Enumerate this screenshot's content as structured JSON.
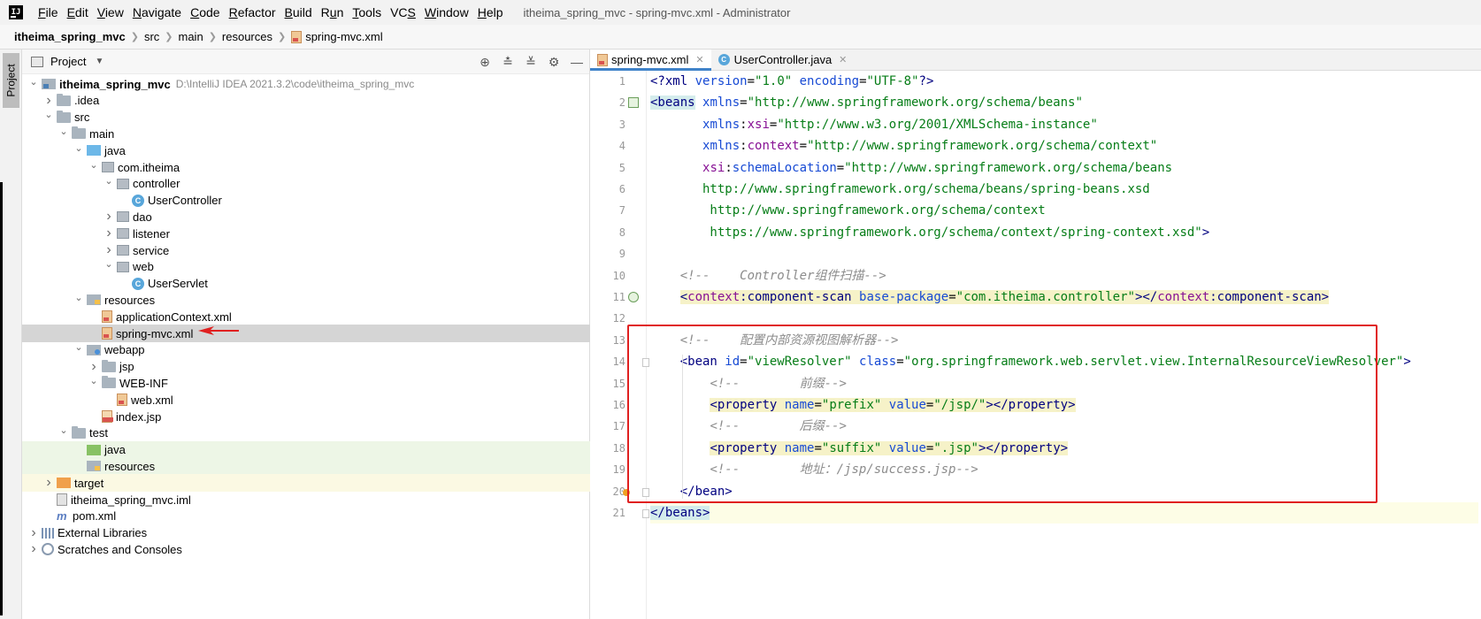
{
  "menubar": {
    "items": [
      "File",
      "Edit",
      "View",
      "Navigate",
      "Code",
      "Refactor",
      "Build",
      "Run",
      "Tools",
      "VCS",
      "Window",
      "Help"
    ],
    "mnemonics": [
      "F",
      "E",
      "V",
      "N",
      "C",
      "R",
      "B",
      "u",
      "T",
      "S",
      "W",
      "H"
    ],
    "window_title": "itheima_spring_mvc - spring-mvc.xml - Administrator"
  },
  "breadcrumb": {
    "project": "itheima_spring_mvc",
    "items": [
      "src",
      "main",
      "resources"
    ],
    "file": "spring-mvc.xml"
  },
  "tool_stripe": {
    "tab_label": "Project"
  },
  "project_panel": {
    "title": "Project",
    "tools": [
      "locate-icon",
      "expand-all-icon",
      "collapse-all-icon",
      "gear-icon",
      "minimize-icon"
    ],
    "tree": [
      {
        "label": "itheima_spring_mvc",
        "path": "D:\\IntelliJ IDEA 2021.3.2\\code\\itheima_spring_mvc",
        "depth": 0,
        "chevron": "down",
        "icon": "module",
        "bold": true
      },
      {
        "label": ".idea",
        "depth": 1,
        "chevron": "right",
        "icon": "folder"
      },
      {
        "label": "src",
        "depth": 1,
        "chevron": "down",
        "icon": "folder"
      },
      {
        "label": "main",
        "depth": 2,
        "chevron": "down",
        "icon": "folder"
      },
      {
        "label": "java",
        "depth": 3,
        "chevron": "down",
        "icon": "folder-blue"
      },
      {
        "label": "com.itheima",
        "depth": 4,
        "chevron": "down",
        "icon": "package"
      },
      {
        "label": "controller",
        "depth": 5,
        "chevron": "down",
        "icon": "package"
      },
      {
        "label": "UserController",
        "depth": 6,
        "chevron": "",
        "icon": "class"
      },
      {
        "label": "dao",
        "depth": 5,
        "chevron": "right",
        "icon": "package"
      },
      {
        "label": "listener",
        "depth": 5,
        "chevron": "right",
        "icon": "package"
      },
      {
        "label": "service",
        "depth": 5,
        "chevron": "right",
        "icon": "package"
      },
      {
        "label": "web",
        "depth": 5,
        "chevron": "down",
        "icon": "package"
      },
      {
        "label": "UserServlet",
        "depth": 6,
        "chevron": "",
        "icon": "class"
      },
      {
        "label": "resources",
        "depth": 3,
        "chevron": "down",
        "icon": "folder-res"
      },
      {
        "label": "applicationContext.xml",
        "depth": 4,
        "chevron": "",
        "icon": "xml"
      },
      {
        "label": "spring-mvc.xml",
        "depth": 4,
        "chevron": "",
        "icon": "xml",
        "selected": true
      },
      {
        "label": "webapp",
        "depth": 3,
        "chevron": "down",
        "icon": "webapp"
      },
      {
        "label": "jsp",
        "depth": 4,
        "chevron": "right",
        "icon": "folder"
      },
      {
        "label": "WEB-INF",
        "depth": 4,
        "chevron": "down",
        "icon": "folder"
      },
      {
        "label": "web.xml",
        "depth": 5,
        "chevron": "",
        "icon": "xml"
      },
      {
        "label": "index.jsp",
        "depth": 4,
        "chevron": "",
        "icon": "jsp"
      },
      {
        "label": "test",
        "depth": 2,
        "chevron": "down",
        "icon": "folder"
      },
      {
        "label": "java",
        "depth": 3,
        "chevron": "",
        "icon": "folder-green",
        "row_style": "test-src"
      },
      {
        "label": "resources",
        "depth": 3,
        "chevron": "",
        "icon": "folder-res",
        "row_style": "test-src"
      },
      {
        "label": "target",
        "depth": 1,
        "chevron": "right",
        "icon": "folder-orange",
        "row_style": "excluded"
      },
      {
        "label": "itheima_spring_mvc.iml",
        "depth": 1,
        "chevron": "",
        "icon": "iml"
      },
      {
        "label": "pom.xml",
        "depth": 1,
        "chevron": "",
        "icon": "maven"
      },
      {
        "label": "External Libraries",
        "depth": 0,
        "chevron": "right",
        "icon": "libs"
      },
      {
        "label": "Scratches and Consoles",
        "depth": 0,
        "chevron": "right",
        "icon": "scratch"
      }
    ]
  },
  "editor": {
    "tabs": [
      {
        "label": "spring-mvc.xml",
        "active": true,
        "icon": "xml-file-icon"
      },
      {
        "label": "UserController.java",
        "active": false,
        "icon": "class-icon"
      }
    ],
    "line_numbers": [
      "1",
      "2",
      "3",
      "4",
      "5",
      "6",
      "7",
      "8",
      "9",
      "10",
      "11",
      "12",
      "13",
      "14",
      "15",
      "16",
      "17",
      "18",
      "19",
      "20",
      "21"
    ],
    "lines": [
      [
        [
          "pi",
          "<?"
        ],
        [
          "pi",
          "xml "
        ],
        [
          "attr",
          "version"
        ],
        [
          "plain",
          "="
        ],
        [
          "val",
          "\"1.0\""
        ],
        [
          "plain",
          " "
        ],
        [
          "attr",
          "encoding"
        ],
        [
          "plain",
          "="
        ],
        [
          "val",
          "\"UTF-8\""
        ],
        [
          "pi",
          "?>"
        ]
      ],
      [
        [
          "tagbg",
          "<beans"
        ],
        [
          "plain",
          " "
        ],
        [
          "attr",
          "xmlns"
        ],
        [
          "plain",
          "="
        ],
        [
          "val",
          "\"http://www.springframework.org/schema/beans\""
        ]
      ],
      [
        [
          "plain",
          "       "
        ],
        [
          "attr",
          "xmlns"
        ],
        [
          "plain",
          ":"
        ],
        [
          "ns",
          "xsi"
        ],
        [
          "plain",
          "="
        ],
        [
          "val",
          "\"http://www.w3.org/2001/XMLSchema-instance\""
        ]
      ],
      [
        [
          "plain",
          "       "
        ],
        [
          "attr",
          "xmlns"
        ],
        [
          "plain",
          ":"
        ],
        [
          "ns",
          "context"
        ],
        [
          "plain",
          "="
        ],
        [
          "val",
          "\"http://www.springframework.org/schema/context\""
        ]
      ],
      [
        [
          "plain",
          "       "
        ],
        [
          "ns",
          "xsi"
        ],
        [
          "plain",
          ":"
        ],
        [
          "attr",
          "schemaLocation"
        ],
        [
          "plain",
          "="
        ],
        [
          "val",
          "\"http://www.springframework.org/schema/beans"
        ]
      ],
      [
        [
          "val",
          "       http://www.springframework.org/schema/beans/spring-beans.xsd"
        ]
      ],
      [
        [
          "val",
          "        http://www.springframework.org/schema/context"
        ]
      ],
      [
        [
          "val",
          "        https://www.springframework.org/schema/context/spring-context.xsd\""
        ],
        [
          "tag",
          ">"
        ]
      ],
      [],
      [
        [
          "plain",
          "    "
        ],
        [
          "comment",
          "<!--    Controller组件扫描-->"
        ]
      ],
      [
        [
          "plain",
          "    "
        ],
        [
          "ctxopen",
          "<"
        ],
        [
          "ctxns",
          "context"
        ],
        [
          "ctxtag",
          ":component-scan"
        ],
        [
          "ctxplain",
          " "
        ],
        [
          "ctxattr",
          "base-package"
        ],
        [
          "ctxplain",
          "="
        ],
        [
          "ctxval",
          "\"com.itheima.controller\""
        ],
        [
          "ctxtag",
          "></"
        ],
        [
          "ctxns",
          "context"
        ],
        [
          "ctxtag",
          ":component-scan>"
        ]
      ],
      [],
      [
        [
          "plain",
          "    "
        ],
        [
          "comment",
          "<!--    配置内部资源视图解析器-->"
        ]
      ],
      [
        [
          "plain",
          "    "
        ],
        [
          "tag",
          "<bean "
        ],
        [
          "attr",
          "id"
        ],
        [
          "plain",
          "="
        ],
        [
          "val",
          "\"viewResolver\""
        ],
        [
          "plain",
          " "
        ],
        [
          "attr",
          "class"
        ],
        [
          "plain",
          "="
        ],
        [
          "val",
          "\"org.springframework.web.servlet.view.InternalResourceViewResolver\""
        ],
        [
          "tag",
          ">"
        ]
      ],
      [
        [
          "plain",
          "        "
        ],
        [
          "comment",
          "<!--        前缀-->"
        ]
      ],
      [
        [
          "plain",
          "        "
        ],
        [
          "ctxopen",
          "<"
        ],
        [
          "ctxtag",
          "property "
        ],
        [
          "ctxattr",
          "name"
        ],
        [
          "ctxplain",
          "="
        ],
        [
          "ctxval",
          "\"prefix\""
        ],
        [
          "ctxplain",
          " "
        ],
        [
          "ctxattr",
          "value"
        ],
        [
          "ctxplain",
          "="
        ],
        [
          "ctxval",
          "\"/jsp/\""
        ],
        [
          "ctxtag",
          "></property>"
        ]
      ],
      [
        [
          "plain",
          "        "
        ],
        [
          "comment",
          "<!--        后缀-->"
        ]
      ],
      [
        [
          "plain",
          "        "
        ],
        [
          "ctxopen",
          "<"
        ],
        [
          "ctxtag",
          "property "
        ],
        [
          "ctxattr",
          "name"
        ],
        [
          "ctxplain",
          "="
        ],
        [
          "ctxval",
          "\"suffix\""
        ],
        [
          "ctxplain",
          " "
        ],
        [
          "ctxattr",
          "value"
        ],
        [
          "ctxplain",
          "="
        ],
        [
          "ctxval",
          "\".jsp\""
        ],
        [
          "ctxtag",
          "></property>"
        ]
      ],
      [
        [
          "plain",
          "        "
        ],
        [
          "comment",
          "<!--        地址：/jsp/success.jsp-->"
        ]
      ],
      [
        [
          "plain",
          "    "
        ],
        [
          "tag",
          "</bean>"
        ]
      ],
      [
        [
          "tagbg",
          "</beans>"
        ]
      ]
    ],
    "current_line": 21
  },
  "colors": {
    "selection": "#d5d5d5",
    "highlight_box": "#e02020",
    "annotation_arrow": "#e02020"
  }
}
